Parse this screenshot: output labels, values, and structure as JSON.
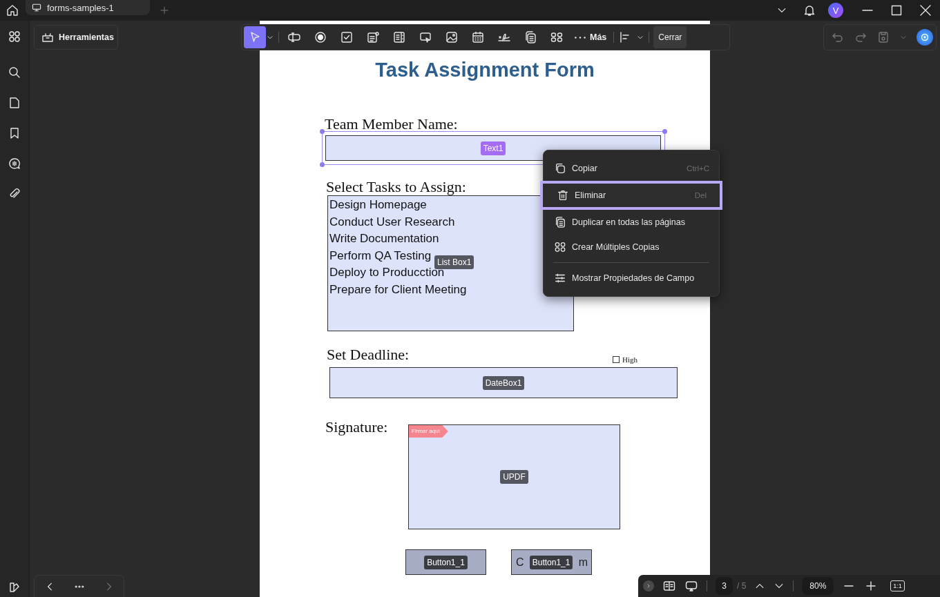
{
  "tab": {
    "title": "forms-samples-1"
  },
  "user": {
    "initial": "V"
  },
  "tools_button": {
    "label": "Herramientas"
  },
  "toolbar": {
    "tools": [
      {
        "kind": "select",
        "selected": true
      },
      {
        "kind": "text-field",
        "selected": false
      },
      {
        "kind": "radio",
        "selected": false
      },
      {
        "kind": "checkbox",
        "selected": false
      },
      {
        "kind": "dropdown",
        "selected": false
      },
      {
        "kind": "list-box",
        "selected": false
      },
      {
        "kind": "push-button",
        "selected": false
      },
      {
        "kind": "image",
        "selected": false
      },
      {
        "kind": "date",
        "selected": false
      },
      {
        "kind": "signature",
        "selected": false
      },
      {
        "kind": "duplicate",
        "selected": false
      },
      {
        "kind": "grid",
        "selected": false
      }
    ],
    "more_label": "Más",
    "close_label": "Cerrar"
  },
  "history": {
    "undo_disabled": true,
    "redo_disabled": true
  },
  "page": {
    "elements": [
      {
        "kind": "title",
        "text": "Task Assignment Form"
      },
      {
        "kind": "label",
        "text": "Team Member Name:"
      },
      {
        "kind": "text-field",
        "tag": "Text1",
        "selected": true
      },
      {
        "kind": "label",
        "text": "Select Tasks to Assign:"
      },
      {
        "kind": "list-box",
        "tag": "List Box1",
        "selected": false,
        "items": [
          "Design Homepage",
          "Conduct User Research",
          "Write Documentation",
          "Perform QA Testing",
          "Deploy to Producction",
          "Prepare for Client Meeting"
        ]
      },
      {
        "kind": "label",
        "text": "Set Deadline:"
      },
      {
        "kind": "checkbox",
        "label": "High",
        "checked": false
      },
      {
        "kind": "date-field",
        "tag": "DateBox1",
        "selected": false
      },
      {
        "kind": "label",
        "text": "Signature:"
      },
      {
        "kind": "signature-field",
        "tag": "UPDF",
        "flag": "Firmar aquí",
        "selected": false
      },
      {
        "kind": "button",
        "tag": "Button1_1",
        "selected": false
      },
      {
        "kind": "button",
        "tag": "Button1_1",
        "selected": false,
        "caption_parts": [
          "C",
          "m"
        ]
      }
    ]
  },
  "context_menu": {
    "items": [
      {
        "label": "Copiar",
        "shortcut": "Ctrl+C",
        "selected": false,
        "separator_before": false
      },
      {
        "label": "Eliminar",
        "shortcut": "Del",
        "selected": true,
        "separator_before": false
      },
      {
        "label": "Duplicar en todas las páginas",
        "selected": false,
        "separator_before": false
      },
      {
        "label": "Crear Múltiples Copias",
        "selected": false,
        "separator_before": false
      },
      {
        "label": "Mostrar Propiedades de Campo",
        "selected": false,
        "separator_before": true
      }
    ]
  },
  "pager": {
    "page": "3",
    "total": "/ 5",
    "zoom": "80%",
    "fit": "1:1"
  }
}
